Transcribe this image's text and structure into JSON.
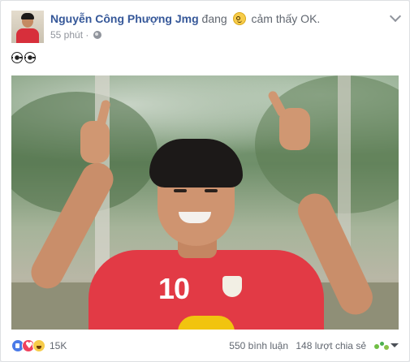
{
  "post": {
    "author": "Nguyễn Công Phượng Jmg",
    "feeling_prefix": "đang",
    "feeling_text": "cảm thấy OK.",
    "time": "55 phút ·",
    "text_icons": [
      "soccer-ball-icon",
      "soccer-ball-icon"
    ]
  },
  "footer": {
    "reactions": [
      "like",
      "love",
      "haha"
    ],
    "reaction_count": "15K",
    "comments": "550 bình luận",
    "shares": "148 lượt chia sẻ"
  },
  "colors": {
    "author_link": "#365899",
    "meta": "#90949c",
    "background": "#e9ebee",
    "jersey": "#e23a45"
  }
}
